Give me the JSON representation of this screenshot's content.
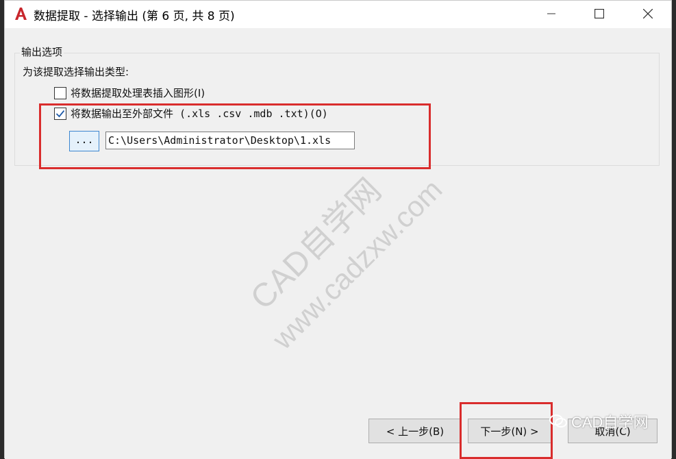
{
  "window": {
    "title": "数据提取 - 选择输出 (第 6 页, 共 8 页)"
  },
  "output_options": {
    "group_title": "输出选项",
    "description": "为该提取选择输出类型:",
    "option_insert_table": {
      "label": "将数据提取处理表插入图形(I)",
      "checked": false
    },
    "option_external_file": {
      "label": "将数据输出至外部文件 (.xls .csv .mdb .txt)(O)",
      "checked": true
    },
    "browse_label": "...",
    "file_path": "C:\\Users\\Administrator\\Desktop\\1.xls"
  },
  "footer": {
    "prev_label": "< 上一步(B)",
    "next_label": "下一步(N) >",
    "cancel_label": "取消(C)"
  },
  "watermark": {
    "line1": "CAD自学网",
    "line2": "www.cadzxw.com"
  },
  "wechat_badge": {
    "text": "CAD自学网"
  },
  "colors": {
    "highlight": "#d92c2c",
    "accent": "#3c86d0",
    "app_icon": "#c8262c"
  }
}
